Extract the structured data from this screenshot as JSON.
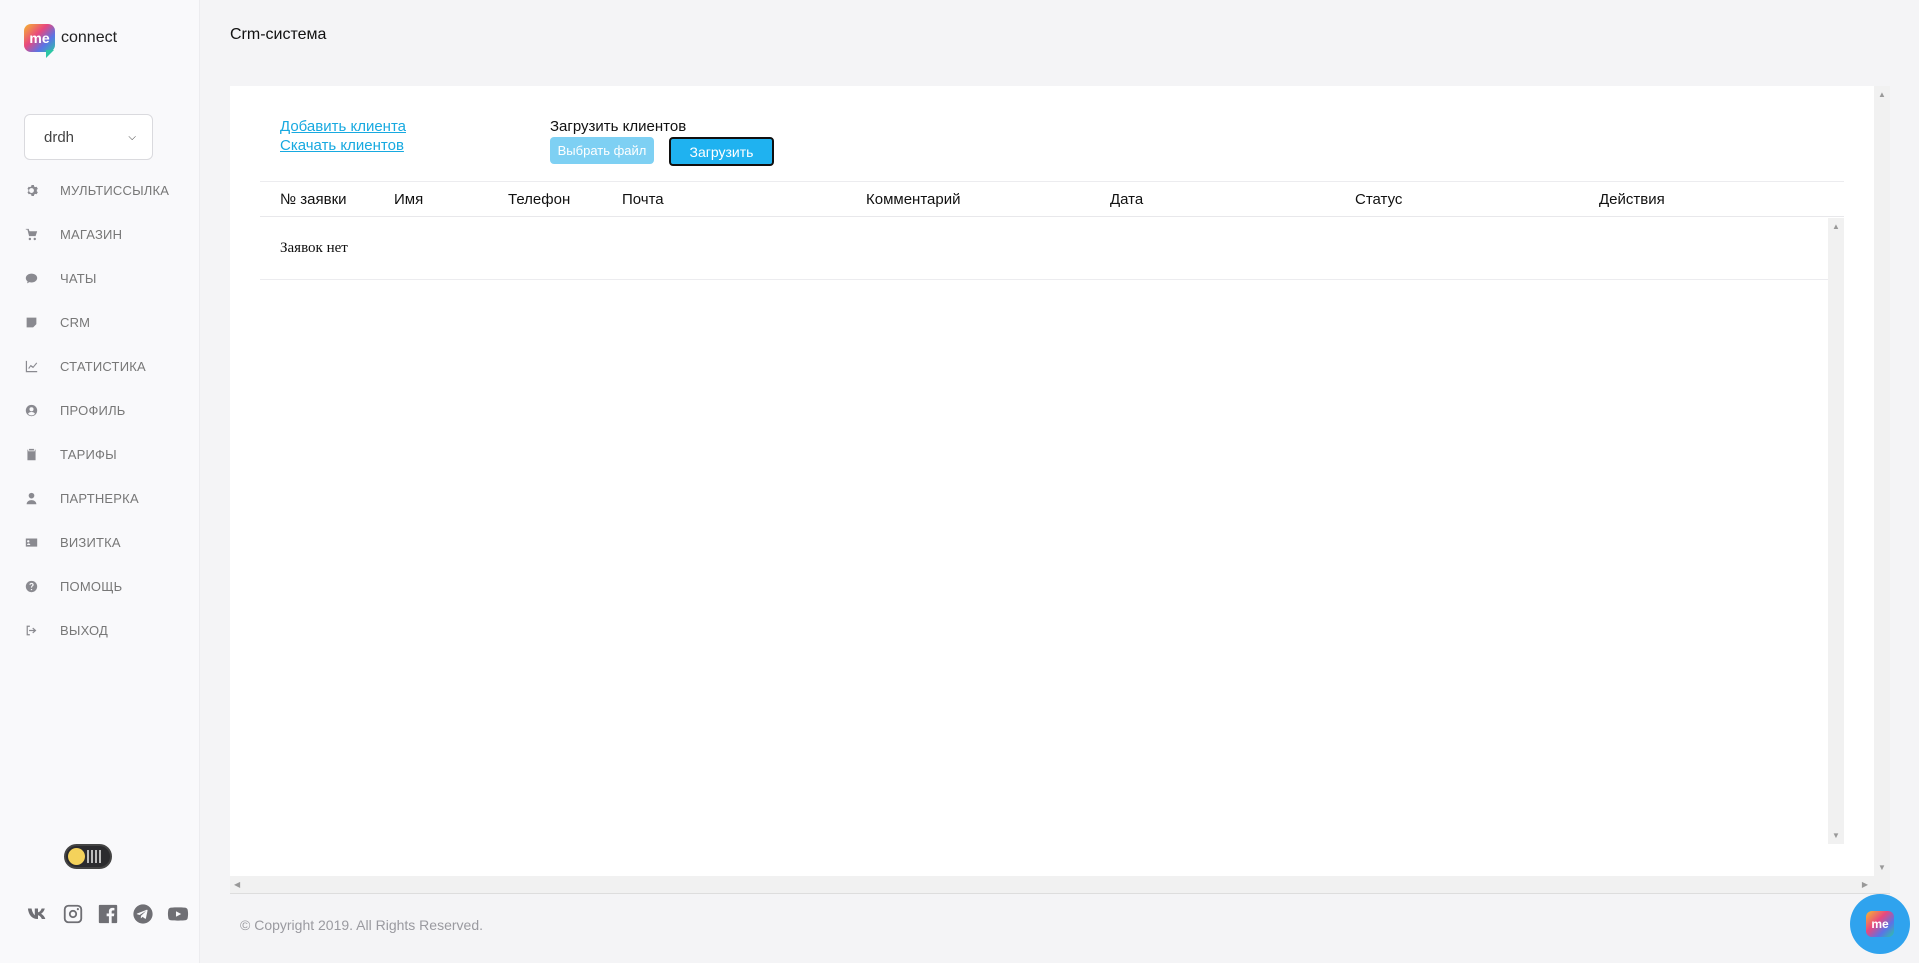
{
  "app": {
    "logo_mark": "me",
    "logo_text": "connect"
  },
  "account_select": {
    "value": "drdh"
  },
  "sidebar": {
    "items": [
      {
        "label": "МУЛЬТИССЫЛКА",
        "icon": "gear-icon"
      },
      {
        "label": "МАГАЗИН",
        "icon": "cart-icon"
      },
      {
        "label": "ЧАТЫ",
        "icon": "chat-icon"
      },
      {
        "label": "CRM",
        "icon": "note-icon"
      },
      {
        "label": "СТАТИСТИКА",
        "icon": "chart-icon"
      },
      {
        "label": "ПРОФИЛЬ",
        "icon": "user-circle-icon"
      },
      {
        "label": "ТАРИФЫ",
        "icon": "clipboard-icon"
      },
      {
        "label": "ПАРТНЕРКА",
        "icon": "user-icon"
      },
      {
        "label": "ВИЗИТКА",
        "icon": "id-card-icon"
      },
      {
        "label": "ПОМОЩЬ",
        "icon": "question-circle-icon"
      },
      {
        "label": "ВЫХОД",
        "icon": "sign-out-icon"
      }
    ]
  },
  "page": {
    "title": "Crm-система"
  },
  "actions": {
    "add_client": "Добавить клиента",
    "download_clients": "Скачать клиентов",
    "upload_label": "Загрузить клиентов",
    "choose_file": "Выбрать файл",
    "upload_button": "Загрузить"
  },
  "table": {
    "columns": [
      "№ заявки",
      "Имя",
      "Телефон",
      "Почта",
      "Комментарий",
      "Дата",
      "Статус",
      "Действия"
    ],
    "empty_text": "Заявок нет"
  },
  "footer": {
    "copyright": "© Copyright 2019. All Rights Reserved."
  },
  "socials": [
    "vk-icon",
    "instagram-icon",
    "facebook-icon",
    "telegram-icon",
    "youtube-icon"
  ],
  "colors": {
    "accent": "#17a9e0",
    "button": "#1fb2f0",
    "button_disabled": "#7ed0f3"
  }
}
